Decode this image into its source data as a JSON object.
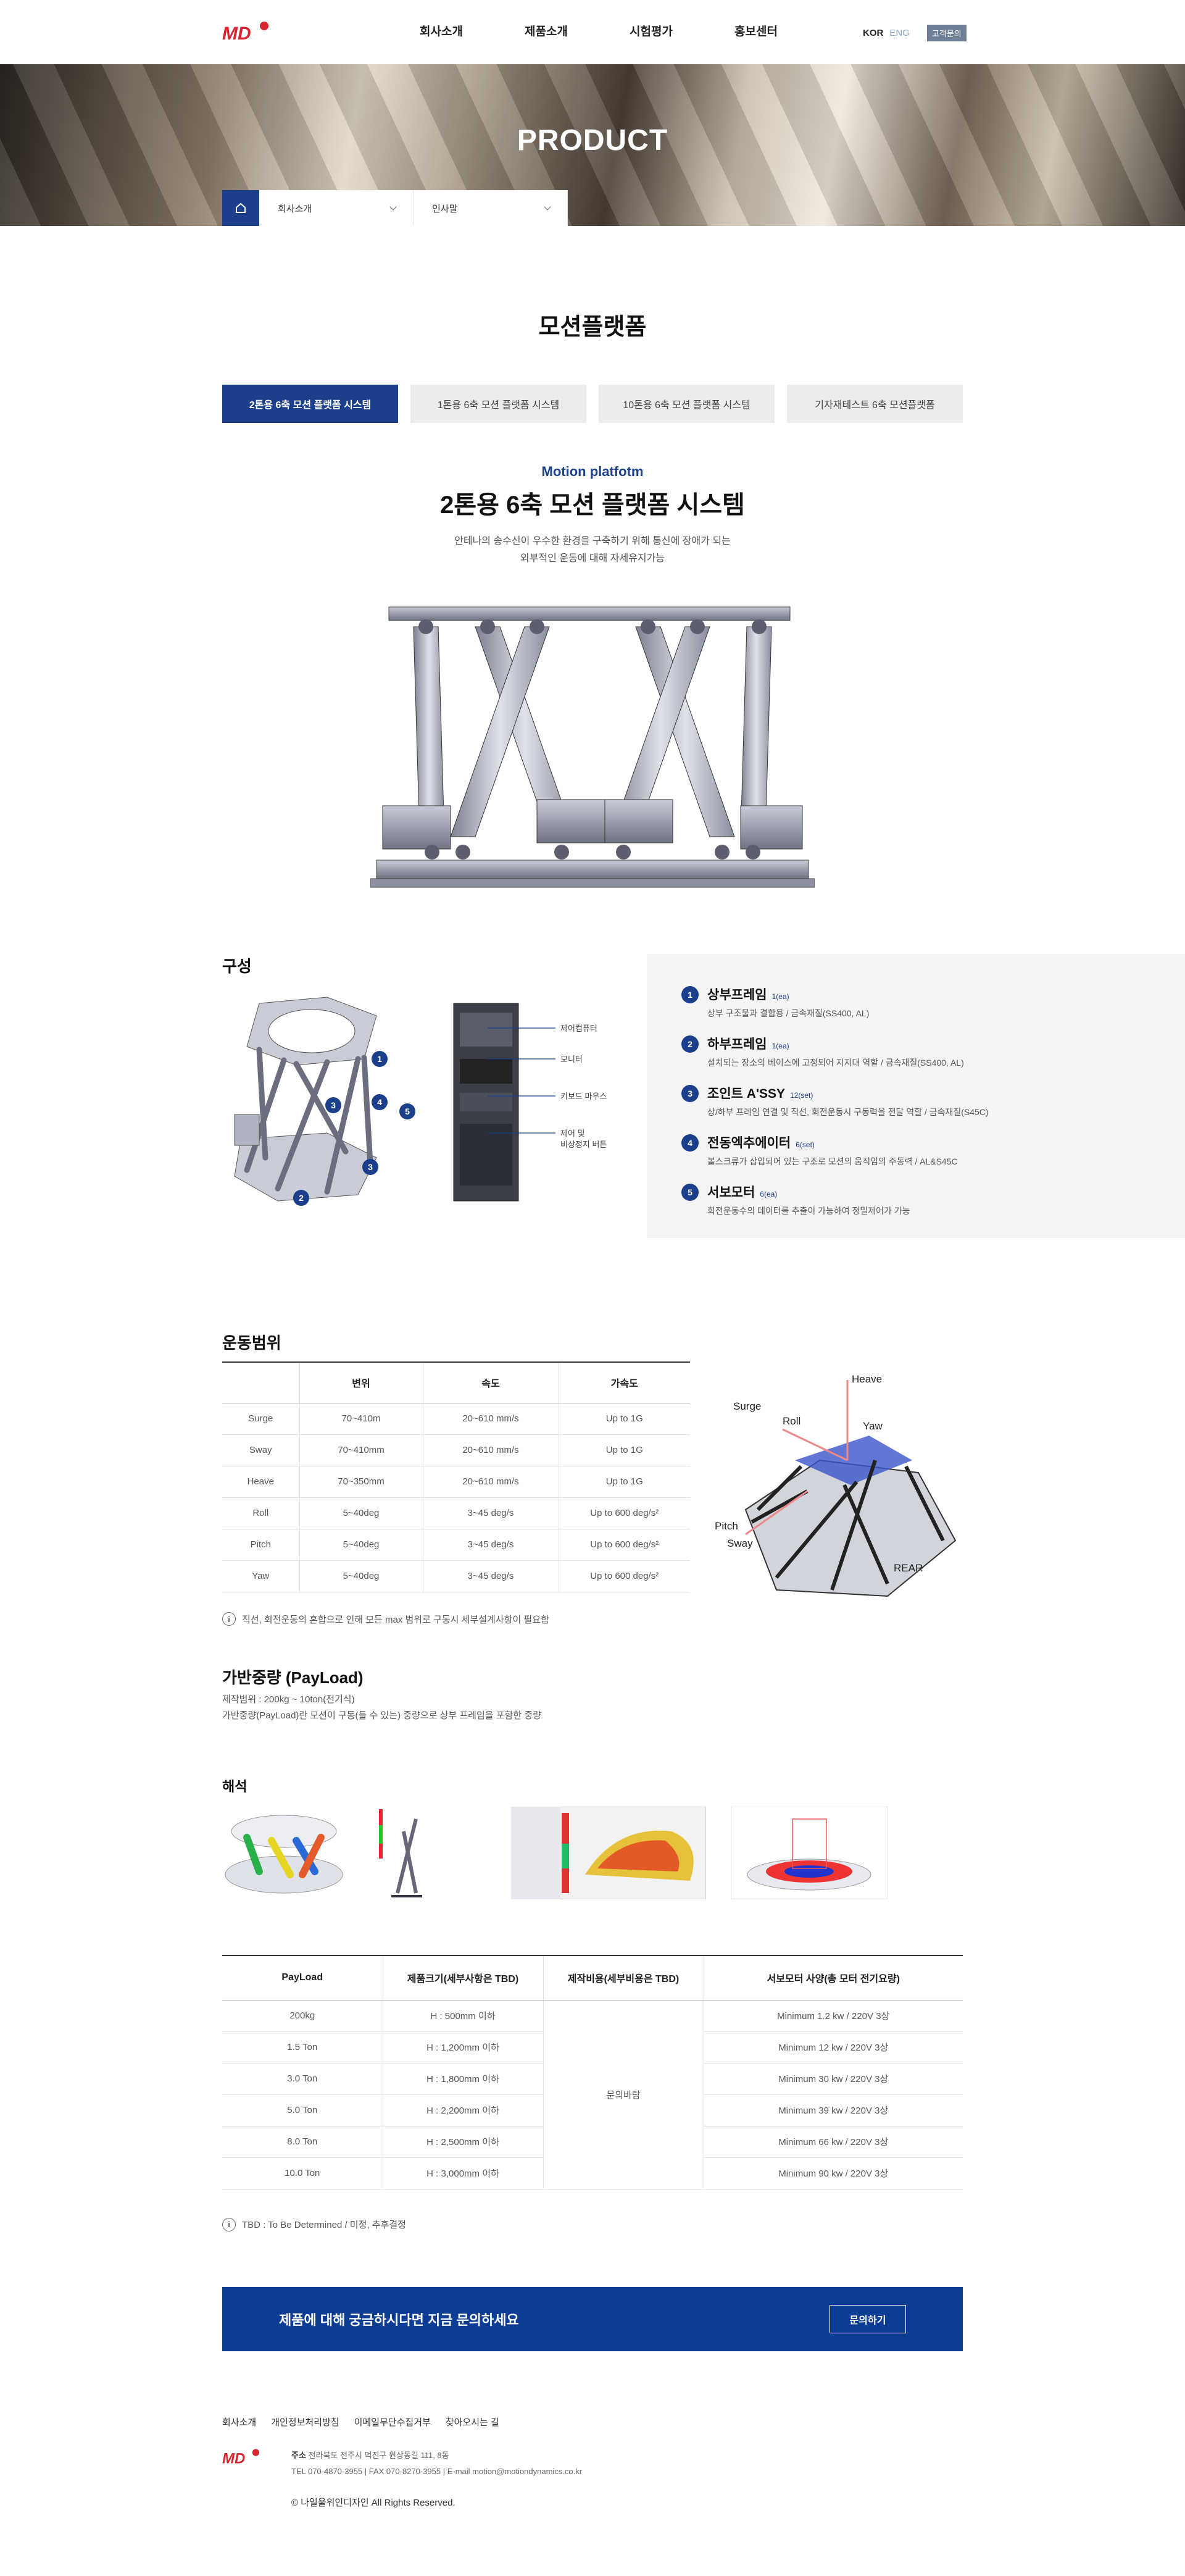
{
  "header": {
    "nav": [
      "회사소개",
      "제품소개",
      "시험평가",
      "홍보센터"
    ],
    "lang_kor": "KOR",
    "lang_eng": "ENG",
    "cs_label": "고객문의"
  },
  "hero": {
    "title": "PRODUCT",
    "subnav_1": "회사소개",
    "subnav_2": "인사말"
  },
  "page": {
    "title": "모션플랫폼",
    "tabs": [
      "2톤용 6축 모션 플랫폼 시스템",
      "1톤용 6축 모션 플랫폼 시스템",
      "10톤용 6축 모션 플랫폼 시스템",
      "기자재테스트 6축 모션플랫폼"
    ],
    "eyebrow": "Motion platfotm",
    "title_main": "2톤용 6축 모션 플랫폼 시스템",
    "desc_1": "안테나의 송수신이 우수한 환경을 구축하기 위해 통신에 장애가 되는",
    "desc_2": "외부적인 운동에 대해 자세유지가능"
  },
  "composition": {
    "title": "구성",
    "labels": [
      "제어컴퓨터",
      "모니터",
      "키보드 마우스",
      "제어 및",
      "비상정지 버튼"
    ],
    "items": [
      {
        "num": "1",
        "name": "상부프레임",
        "qty": "1(ea)",
        "desc": "상부 구조물과 결합용 / 금속재질(SS400, AL)"
      },
      {
        "num": "2",
        "name": "하부프레임",
        "qty": "1(ea)",
        "desc": "설치되는 장소의 베이스에 고정되어 지지대 역할 / 금속재질(SS400, AL)"
      },
      {
        "num": "3",
        "name": "조인트 A'SSY",
        "qty": "12(set)",
        "desc": "상/하부 프레임 연결 및 직선, 회전운동시 구동력을 전달 역할 / 금속재질(S45C)"
      },
      {
        "num": "4",
        "name": "전동엑추에이터",
        "qty": "6(set)",
        "desc": "볼스크류가 삽입되어 있는 구조로 모션의 움직임의 주동력 / AL&S45C"
      },
      {
        "num": "5",
        "name": "서보모터",
        "qty": "6(ea)",
        "desc": "회전운동수의 데이터를 추출이 가능하여 정밀제어가 가능"
      }
    ]
  },
  "range": {
    "title": "운동범위",
    "headers": [
      "",
      "변위",
      "속도",
      "가속도"
    ],
    "rows": [
      [
        "Surge",
        "70~410m",
        "20~610 mm/s",
        "Up to 1G"
      ],
      [
        "Sway",
        "70~410mm",
        "20~610 mm/s",
        "Up to 1G"
      ],
      [
        "Heave",
        "70~350mm",
        "20~610 mm/s",
        "Up to 1G"
      ],
      [
        "Roll",
        "5~40deg",
        "3~45 deg/s",
        "Up to 600 deg/s²"
      ],
      [
        "Pitch",
        "5~40deg",
        "3~45 deg/s",
        "Up to 600 deg/s²"
      ],
      [
        "Yaw",
        "5~40deg",
        "3~45 deg/s",
        "Up to 600 deg/s²"
      ]
    ],
    "note": "직선, 회전운동의 혼합으로 인해 모든 max 범위로 구동시 세부설계사항이 필요함",
    "axis_labels": [
      "Heave",
      "Surge",
      "Roll",
      "Yaw",
      "Pitch",
      "Sway",
      "REAR"
    ]
  },
  "payload": {
    "title": "가반중량 (PayLoad)",
    "line_1": "제작범위 : 200kg ~ 10ton(전기식)",
    "line_2": "가반중량(PayLoad)란 모션이 구동(들 수 있는) 중량으로 상부 프레임을 포함한 중량"
  },
  "analysis": {
    "title": "해석"
  },
  "spec": {
    "headers": [
      "PayLoad",
      "제품크기(세부사항은 TBD)",
      "제작비용(세부비용은 TBD)",
      "서보모터 사양(총 모터 전기요량)"
    ],
    "cost_merged": "문의바람",
    "rows": [
      [
        "200kg",
        "H : 500mm 이하",
        "Minimum 1.2 kw / 220V 3상"
      ],
      [
        "1.5 Ton",
        "H : 1,200mm 이하",
        "Minimum 12 kw / 220V 3상"
      ],
      [
        "3.0 Ton",
        "H : 1,800mm 이하",
        "Minimum 30 kw / 220V 3상"
      ],
      [
        "5.0 Ton",
        "H : 2,200mm 이하",
        "Minimum 39 kw / 220V 3상"
      ],
      [
        "8.0 Ton",
        "H : 2,500mm 이하",
        "Minimum 66 kw / 220V 3상"
      ],
      [
        "10.0 Ton",
        "H : 3,000mm 이하",
        "Minimum 90 kw / 220V 3상"
      ]
    ],
    "note": "TBD : To Be Determined / 미정, 추후결정"
  },
  "cta": {
    "text": "제품에 대해 궁금하시다면 지금 문의하세요",
    "button": "문의하기"
  },
  "footer": {
    "links": [
      "회사소개",
      "개인정보처리방침",
      "이메일무단수집거부",
      "찾아오시는 길"
    ],
    "addr_label": "주소",
    "addr": "전라북도 전주시 덕진구 원상동길 111, 8동",
    "tel": "TEL 070-4870-3955 | FAX 070-8270-3955 | E-mail motion@motiondynamics.co.kr",
    "copy": "© 나일울위인디자인 All Rights Reserved."
  },
  "colors": {
    "primary": "#1b3f8b",
    "cta": "#0c3d94",
    "logo_red": "#d9232e"
  }
}
